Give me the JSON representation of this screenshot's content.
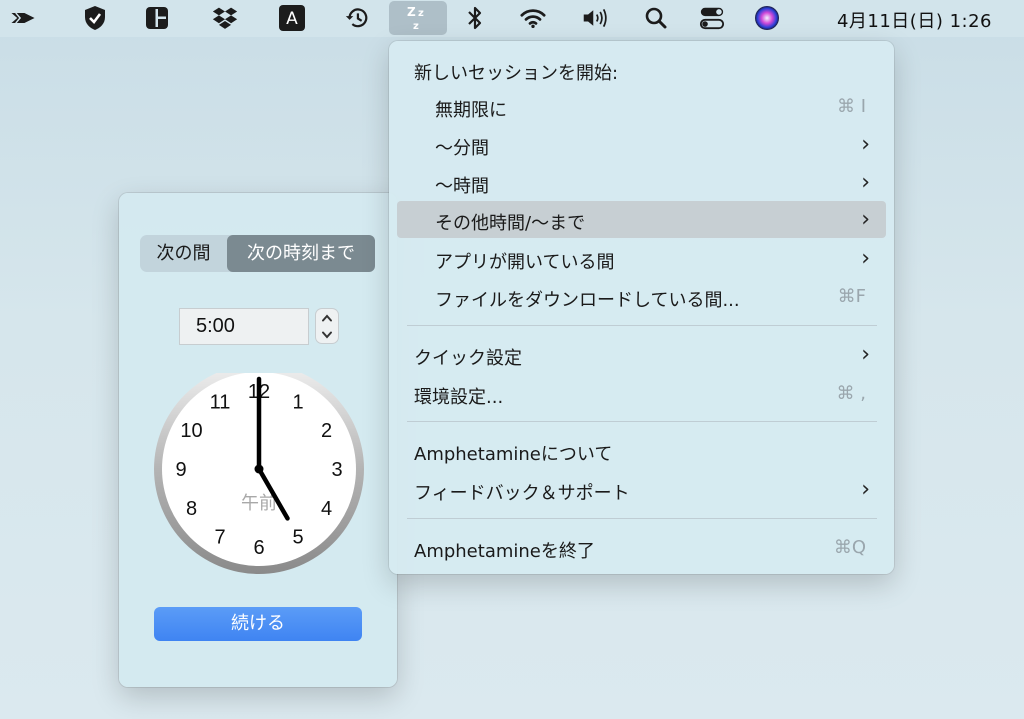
{
  "menubar": {
    "icons": [
      "arrow-icon",
      "shield-check-icon",
      "window-layout-icon",
      "dropbox-icon",
      "input-source-icon",
      "time-machine-icon",
      "amphetamine-zzz-icon",
      "bluetooth-icon",
      "wifi-icon",
      "volume-icon",
      "search-icon",
      "control-center-icon",
      "siri-icon"
    ],
    "input_source_letter": "A",
    "datetime": "4月11日(日)  1:26"
  },
  "menu": {
    "header": "新しいセッションを開始:",
    "items": [
      {
        "label": "無期限に",
        "shortcut": "⌘ I",
        "submenu": false
      },
      {
        "label": "〜分間",
        "shortcut": "",
        "submenu": true
      },
      {
        "label": "〜時間",
        "shortcut": "",
        "submenu": true
      },
      {
        "label": "その他時間/〜まで",
        "shortcut": "",
        "submenu": true,
        "highlighted": true
      },
      {
        "label": "アプリが開いている間",
        "shortcut": "",
        "submenu": true
      },
      {
        "label": "ファイルをダウンロードしている間...",
        "shortcut": "⌘F",
        "submenu": false
      }
    ],
    "quick_settings": "クイック設定",
    "preferences": {
      "label": "環境設定...",
      "shortcut": "⌘ ,"
    },
    "about": "Amphetamineについて",
    "feedback": "フィードバック＆サポート",
    "quit": {
      "label": "Amphetamineを終了",
      "shortcut": "⌘Q"
    }
  },
  "panel": {
    "segments": [
      "次の間",
      "次の時刻まで"
    ],
    "selected_segment": 1,
    "time_value": "5:00",
    "clock": {
      "numbers": [
        "12",
        "1",
        "2",
        "3",
        "4",
        "5",
        "6",
        "7",
        "8",
        "9",
        "10",
        "11"
      ],
      "am_pm": "午前",
      "hour": 5,
      "minute": 0
    },
    "continue_label": "続ける"
  },
  "colors": {
    "accent": "#3f84f2",
    "menu_highlight": "#c7cfd3",
    "segment_selected": "#7b8a91"
  }
}
